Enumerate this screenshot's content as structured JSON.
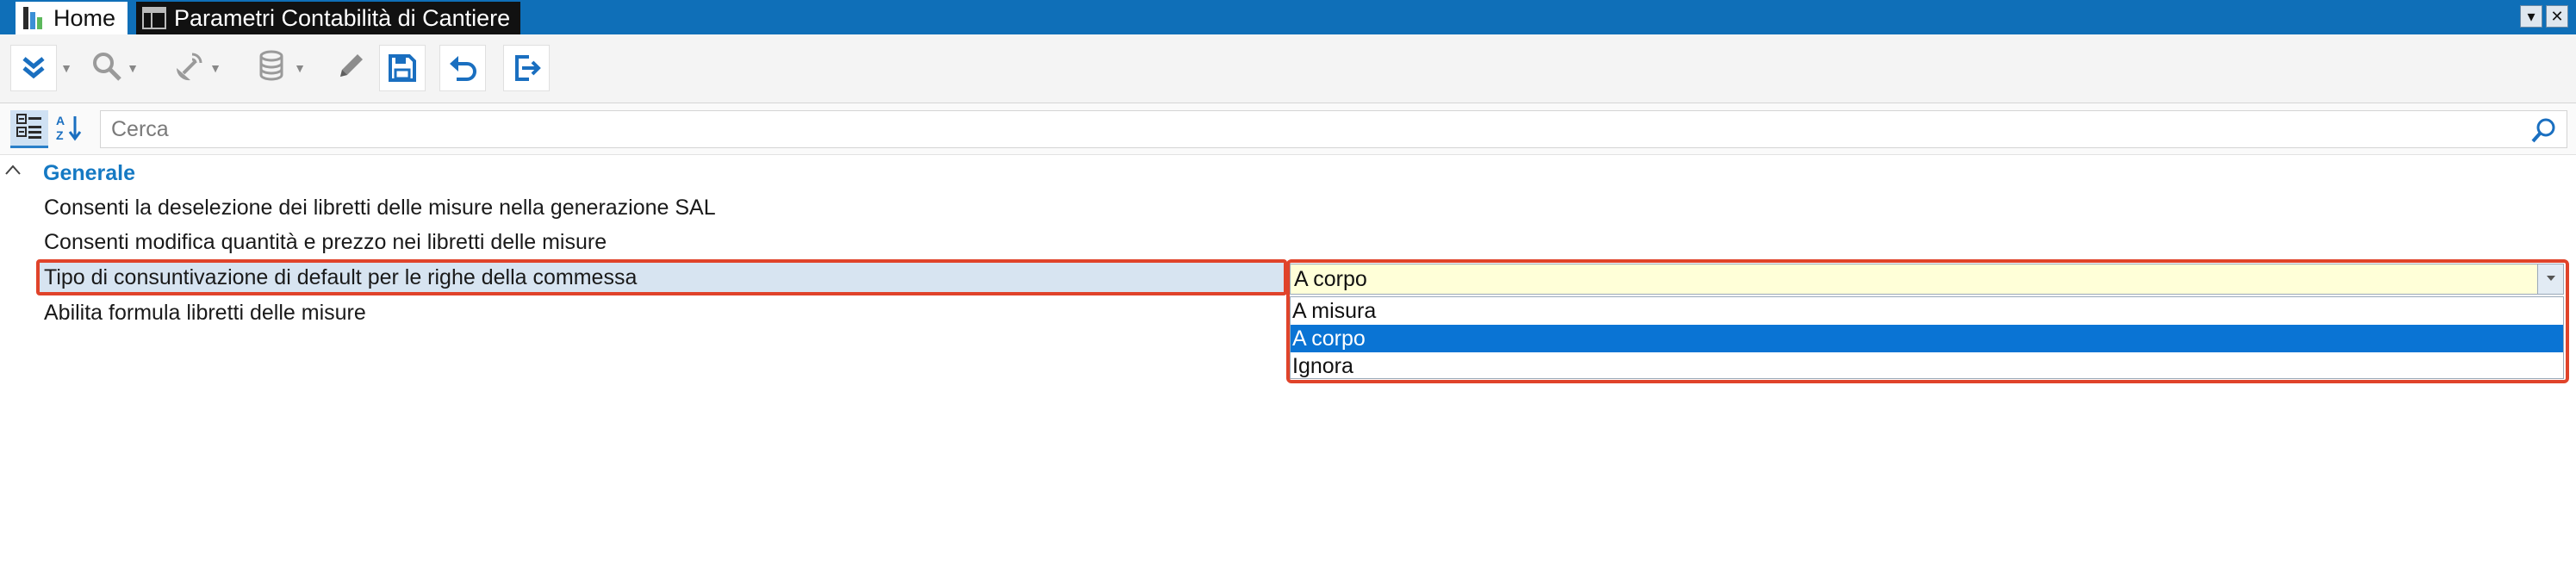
{
  "tabs": {
    "home": "Home",
    "active": "Parametri Contabilità di Cantiere"
  },
  "window_controls": {
    "dropdown": "▾",
    "close": "✕"
  },
  "toolbar": {
    "icons": [
      "expand-icon",
      "search-icon",
      "satellite-icon",
      "database-icon",
      "pencil-icon",
      "save-icon",
      "undo-icon",
      "exit-icon"
    ]
  },
  "filter": {
    "search_placeholder": "Cerca"
  },
  "grid": {
    "category": "Generale",
    "rows": [
      {
        "label": "Consenti la deselezione dei libretti delle misure nella generazione SAL"
      },
      {
        "label": "Consenti modifica quantità e prezzo nei libretti delle misure"
      },
      {
        "label": "Tipo di consuntivazione di default per le righe della commessa"
      },
      {
        "label": "Abilita formula libretti delle misure"
      }
    ],
    "combo": {
      "value": "A corpo",
      "options": [
        "A misura",
        "A corpo",
        "Ignora"
      ],
      "selected_index": 1
    }
  },
  "colors": {
    "title_bar": "#0f6fb8",
    "accent": "#1579c3",
    "highlight": "#e0432a",
    "selected_option": "#0a74d4",
    "combo_background": "#ffffd8"
  }
}
